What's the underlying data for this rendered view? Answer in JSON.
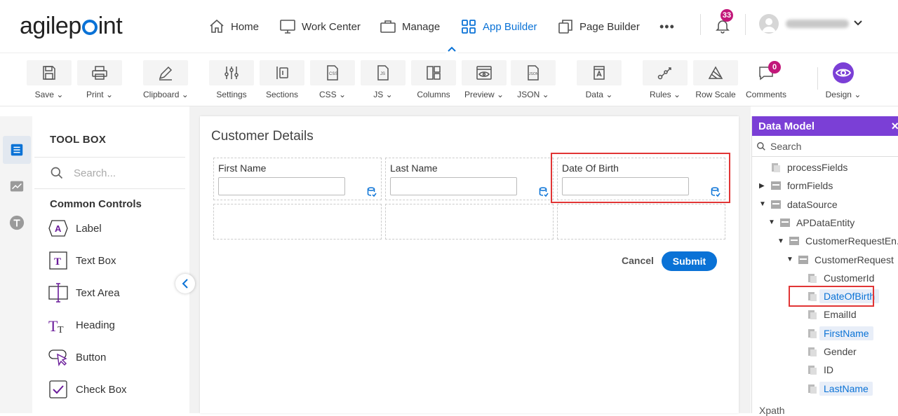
{
  "logo": {
    "text_pre": "agilep",
    "text_post": "int"
  },
  "nav": {
    "items": [
      {
        "label": "Home",
        "icon": "home-icon"
      },
      {
        "label": "Work Center",
        "icon": "monitor-icon"
      },
      {
        "label": "Manage",
        "icon": "briefcase-icon"
      },
      {
        "label": "App Builder",
        "icon": "grid-icon"
      },
      {
        "label": "Page Builder",
        "icon": "copy-icon"
      }
    ],
    "notifications": "33",
    "more": "•••"
  },
  "toolbar": {
    "items": [
      {
        "label": "Save",
        "caret": true
      },
      {
        "label": "Print",
        "caret": true
      },
      {
        "label": "Clipboard",
        "caret": true
      },
      {
        "label": "Settings",
        "caret": false
      },
      {
        "label": "Sections",
        "caret": false
      },
      {
        "label": "CSS",
        "caret": true
      },
      {
        "label": "JS",
        "caret": true
      },
      {
        "label": "Columns",
        "caret": false
      },
      {
        "label": "Preview",
        "caret": true
      },
      {
        "label": "JSON",
        "caret": true
      },
      {
        "label": "Data",
        "caret": true
      },
      {
        "label": "Rules",
        "caret": true
      },
      {
        "label": "Row Scale",
        "caret": false
      },
      {
        "label": "Comments",
        "caret": false
      },
      {
        "label": "Design",
        "caret": true
      }
    ],
    "comments_count": "0"
  },
  "toolbox": {
    "title": "TOOL BOX",
    "search_placeholder": "Search...",
    "section": "Common Controls",
    "controls": [
      "Label",
      "Text Box",
      "Text Area",
      "Heading",
      "Button",
      "Check Box"
    ]
  },
  "form": {
    "title": "Customer Details",
    "fields": [
      "First Name",
      "Last Name",
      "Date Of Birth"
    ],
    "cancel": "Cancel",
    "submit": "Submit"
  },
  "data_model": {
    "title": "Data Model",
    "close": "×",
    "search_placeholder": "Search",
    "nodes": [
      {
        "label": "processFields",
        "level": 0,
        "arrow": ""
      },
      {
        "label": "formFields",
        "level": 0,
        "arrow": "▶"
      },
      {
        "label": "dataSource",
        "level": 0,
        "arrow": "▼"
      },
      {
        "label": "APDataEntity",
        "level": 1,
        "arrow": "▼"
      },
      {
        "label": "CustomerRequestEn...",
        "level": 2,
        "arrow": "▼"
      },
      {
        "label": "CustomerRequest",
        "level": 3,
        "arrow": "▼"
      },
      {
        "label": "CustomerId",
        "level": 4,
        "arrow": ""
      },
      {
        "label": "DateOfBirth",
        "level": 4,
        "arrow": "",
        "selected": true
      },
      {
        "label": "EmailId",
        "level": 4,
        "arrow": ""
      },
      {
        "label": "FirstName",
        "level": 4,
        "arrow": "",
        "selected": true
      },
      {
        "label": "Gender",
        "level": 4,
        "arrow": ""
      },
      {
        "label": "ID",
        "level": 4,
        "arrow": ""
      },
      {
        "label": "LastName",
        "level": 4,
        "arrow": "",
        "selected": true
      }
    ],
    "xpath": "Xpath"
  },
  "colors": {
    "accent": "#0a72d6",
    "purple": "#7b3fd6",
    "badge": "#c2187a",
    "highlight": "#e13535"
  }
}
